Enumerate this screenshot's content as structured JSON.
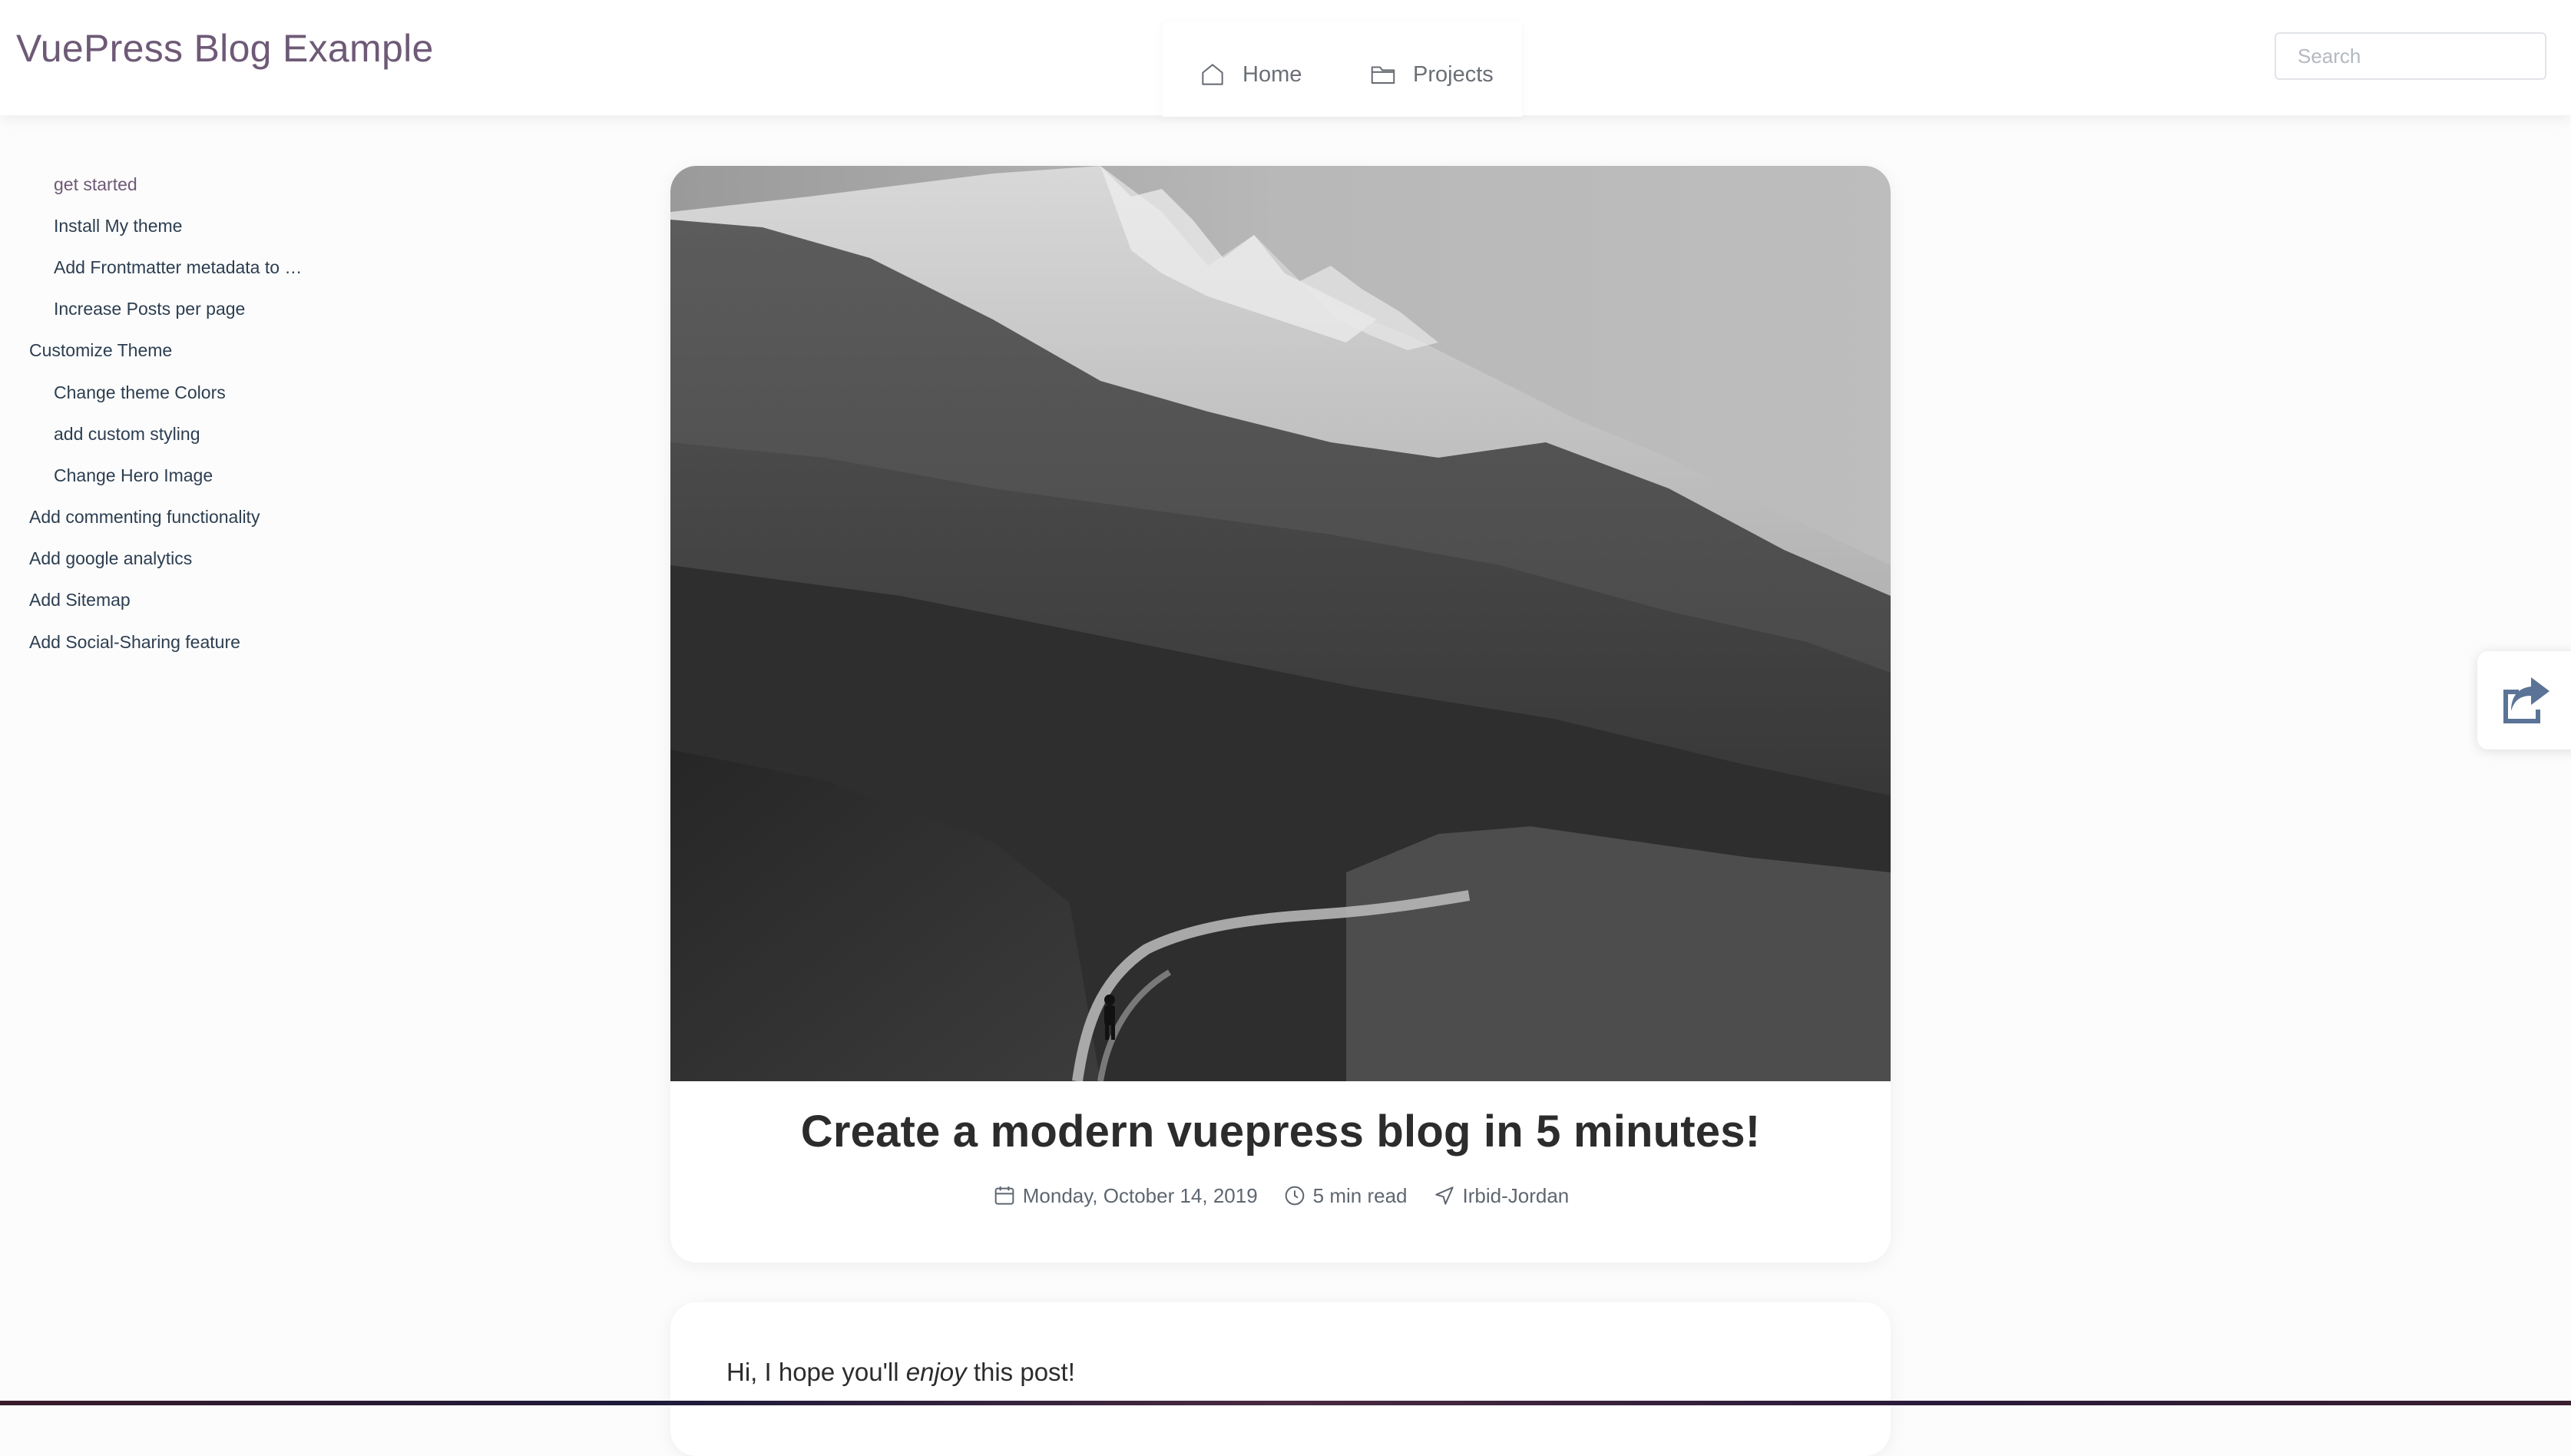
{
  "header": {
    "site_title": "VuePress Blog Example",
    "nav": [
      {
        "label": "Home",
        "icon": "home-icon"
      },
      {
        "label": "Projects",
        "icon": "folder-icon"
      }
    ],
    "search_placeholder": "Search"
  },
  "sidebar": {
    "items": [
      {
        "label": "get started",
        "level": 2,
        "active": true
      },
      {
        "label": "Install My theme",
        "level": 2
      },
      {
        "label": "Add Frontmatter metadata to …",
        "level": 2
      },
      {
        "label": "Increase Posts per page",
        "level": 2
      },
      {
        "label": "Customize Theme",
        "level": 1
      },
      {
        "label": "Change theme Colors",
        "level": 2
      },
      {
        "label": "add custom styling",
        "level": 2
      },
      {
        "label": "Change Hero Image",
        "level": 2
      },
      {
        "label": "Add commenting functionality",
        "level": 1
      },
      {
        "label": "Add google analytics",
        "level": 1
      },
      {
        "label": "Add Sitemap",
        "level": 1
      },
      {
        "label": "Add Social-Sharing feature",
        "level": 1
      }
    ]
  },
  "post": {
    "title": "Create a modern vuepress blog in 5 minutes!",
    "date": "Monday, October 14, 2019",
    "read_time": "5 min read",
    "location": "Irbid-Jordan",
    "intro_before": "Hi, I hope you'll ",
    "intro_em": "enjoy",
    "intro_after": " this post!"
  },
  "share": {
    "icon": "share-icon"
  },
  "colors": {
    "accent": "#6e5a77",
    "text": "#2c3e50",
    "share_icon": "#5b7396"
  }
}
